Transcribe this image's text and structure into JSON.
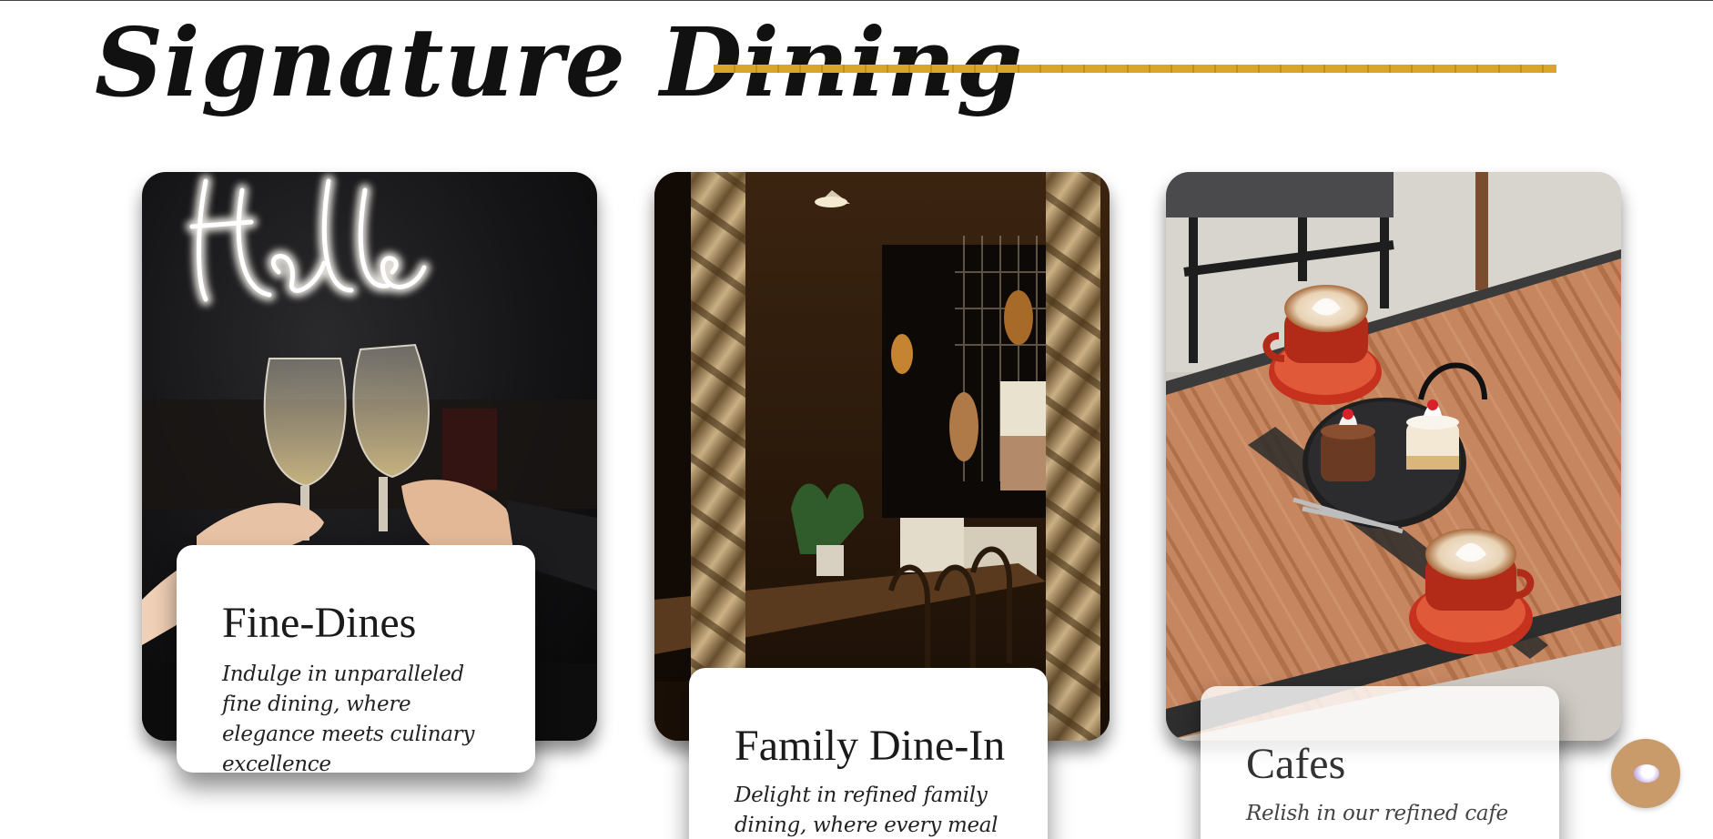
{
  "header": {
    "title": "Signature Dining",
    "accent_color": "#d9a62a"
  },
  "cards": [
    {
      "title": "Fine-Dines",
      "description": "Indulge in unparalleled fine dining, where elegance meets culinary excellence",
      "image_subject": "neon-sign-with-wine-glasses-toast"
    },
    {
      "title": "Family Dine-In",
      "description": "Delight in refined family dining, where every meal",
      "image_subject": "restaurant-interior-framed-by-ropes"
    },
    {
      "title": "Cafes",
      "description": "Relish in our refined cafe",
      "image_subject": "latte-cups-and-cakes-on-wooden-table"
    }
  ],
  "chat_widget": {
    "icon": "chat-bubble-icon",
    "color": "#c99b6a"
  }
}
